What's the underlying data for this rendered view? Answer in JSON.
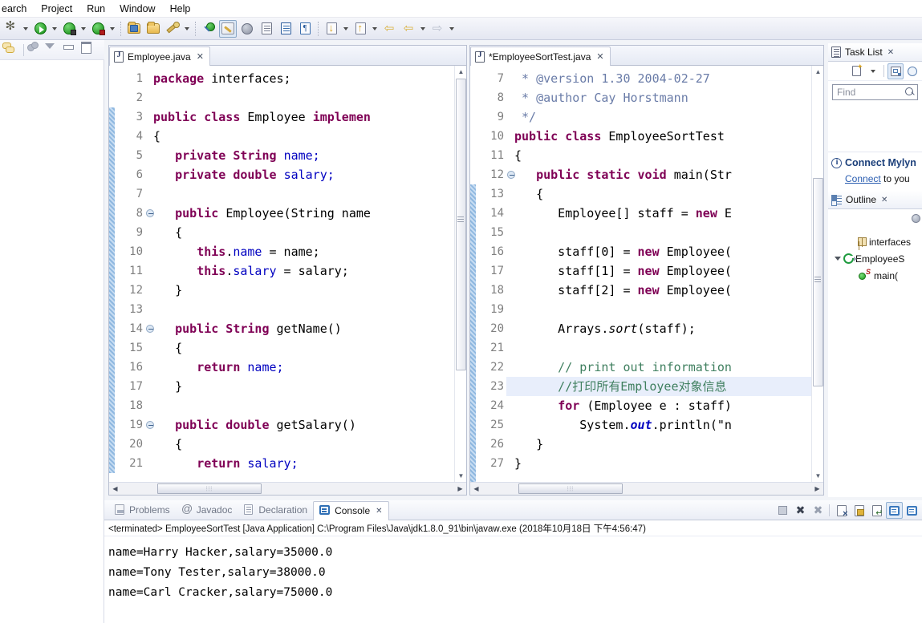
{
  "menubar": {
    "items": [
      "earch",
      "Project",
      "Run",
      "Window",
      "Help"
    ]
  },
  "toolbar": {
    "icons": [
      "debug-icon",
      "dropdown-arrow",
      "run-icon",
      "dropdown-arrow",
      "debug-as-icon",
      "dropdown-arrow",
      "coverage-icon",
      "dropdown-arrow",
      "new-java-project-icon",
      "open-folder-icon",
      "new-wizard-icon",
      "dropdown-arrow",
      "search-pin-icon",
      "toggle-mark-occurrences-icon",
      "link-icon",
      "open-type-icon",
      "open-task-icon",
      "pilcrow-icon",
      "next-annotation-icon",
      "dropdown-arrow",
      "previous-annotation-icon",
      "dropdown-arrow",
      "back-icon",
      "forward-icon",
      "dropdown-arrow",
      "forward-hollow-icon",
      "dropdown-arrow"
    ]
  },
  "left_strip": {
    "icons": [
      "link-with-editor-icon",
      "view-menu-balls-icon",
      "view-menu-icon",
      "minimize-icon",
      "maximize-icon"
    ]
  },
  "editors": [
    {
      "tab_label": "Employee.java",
      "dirty": false,
      "close_label": "✕",
      "first_line": 1,
      "lines": [
        {
          "n": 1,
          "fold": false,
          "highlight": false,
          "tokens": [
            {
              "t": "package ",
              "c": "kw"
            },
            {
              "t": "interfaces;",
              "c": "pln"
            }
          ]
        },
        {
          "n": 2,
          "fold": false,
          "highlight": false,
          "tokens": []
        },
        {
          "n": 3,
          "fold": false,
          "highlight": false,
          "tokens": [
            {
              "t": "public class ",
              "c": "kw"
            },
            {
              "t": "Employee ",
              "c": "pln"
            },
            {
              "t": "implemen",
              "c": "kw"
            }
          ]
        },
        {
          "n": 4,
          "fold": false,
          "highlight": false,
          "tokens": [
            {
              "t": "{",
              "c": "pln"
            }
          ]
        },
        {
          "n": 5,
          "fold": false,
          "highlight": false,
          "tokens": [
            {
              "t": "   ",
              "c": "pln"
            },
            {
              "t": "private String ",
              "c": "kw"
            },
            {
              "t": "name;",
              "c": "fld"
            }
          ]
        },
        {
          "n": 6,
          "fold": false,
          "highlight": false,
          "tokens": [
            {
              "t": "   ",
              "c": "pln"
            },
            {
              "t": "private double ",
              "c": "kw"
            },
            {
              "t": "salary;",
              "c": "fld"
            }
          ]
        },
        {
          "n": 7,
          "fold": false,
          "highlight": false,
          "tokens": []
        },
        {
          "n": 8,
          "fold": true,
          "highlight": false,
          "tokens": [
            {
              "t": "   ",
              "c": "pln"
            },
            {
              "t": "public ",
              "c": "kw"
            },
            {
              "t": "Employee(String name",
              "c": "pln"
            }
          ]
        },
        {
          "n": 9,
          "fold": false,
          "highlight": false,
          "tokens": [
            {
              "t": "   {",
              "c": "pln"
            }
          ]
        },
        {
          "n": 10,
          "fold": false,
          "highlight": false,
          "tokens": [
            {
              "t": "      ",
              "c": "pln"
            },
            {
              "t": "this",
              "c": "kw"
            },
            {
              "t": ".",
              "c": "pln"
            },
            {
              "t": "name",
              "c": "fld"
            },
            {
              "t": " = name;",
              "c": "pln"
            }
          ]
        },
        {
          "n": 11,
          "fold": false,
          "highlight": false,
          "tokens": [
            {
              "t": "      ",
              "c": "pln"
            },
            {
              "t": "this",
              "c": "kw"
            },
            {
              "t": ".",
              "c": "pln"
            },
            {
              "t": "salary",
              "c": "fld"
            },
            {
              "t": " = salary;",
              "c": "pln"
            }
          ]
        },
        {
          "n": 12,
          "fold": false,
          "highlight": false,
          "tokens": [
            {
              "t": "   }",
              "c": "pln"
            }
          ]
        },
        {
          "n": 13,
          "fold": false,
          "highlight": false,
          "tokens": []
        },
        {
          "n": 14,
          "fold": true,
          "highlight": false,
          "tokens": [
            {
              "t": "   ",
              "c": "pln"
            },
            {
              "t": "public String ",
              "c": "kw"
            },
            {
              "t": "getName()",
              "c": "pln"
            }
          ]
        },
        {
          "n": 15,
          "fold": false,
          "highlight": false,
          "tokens": [
            {
              "t": "   {",
              "c": "pln"
            }
          ]
        },
        {
          "n": 16,
          "fold": false,
          "highlight": false,
          "tokens": [
            {
              "t": "      ",
              "c": "pln"
            },
            {
              "t": "return ",
              "c": "kw"
            },
            {
              "t": "name;",
              "c": "fld"
            }
          ]
        },
        {
          "n": 17,
          "fold": false,
          "highlight": false,
          "tokens": [
            {
              "t": "   }",
              "c": "pln"
            }
          ]
        },
        {
          "n": 18,
          "fold": false,
          "highlight": false,
          "tokens": []
        },
        {
          "n": 19,
          "fold": true,
          "highlight": false,
          "tokens": [
            {
              "t": "   ",
              "c": "pln"
            },
            {
              "t": "public double ",
              "c": "kw"
            },
            {
              "t": "getSalary()",
              "c": "pln"
            }
          ]
        },
        {
          "n": 20,
          "fold": false,
          "highlight": false,
          "tokens": [
            {
              "t": "   {",
              "c": "pln"
            }
          ]
        },
        {
          "n": 21,
          "fold": false,
          "highlight": false,
          "tokens": [
            {
              "t": "      ",
              "c": "pln"
            },
            {
              "t": "return ",
              "c": "kw"
            },
            {
              "t": "salary;",
              "c": "fld"
            }
          ]
        }
      ]
    },
    {
      "tab_label": "*EmployeeSortTest.java",
      "dirty": true,
      "close_label": "✕",
      "first_line": 7,
      "lines": [
        {
          "n": 7,
          "fold": false,
          "highlight": false,
          "tokens": [
            {
              "t": " * ",
              "c": "doc"
            },
            {
              "t": "@version ",
              "c": "doc"
            },
            {
              "t": "1.30 2004-02-27",
              "c": "doc"
            }
          ]
        },
        {
          "n": 8,
          "fold": false,
          "highlight": false,
          "tokens": [
            {
              "t": " * ",
              "c": "doc"
            },
            {
              "t": "@author ",
              "c": "doc"
            },
            {
              "t": "Cay Horstmann",
              "c": "doc"
            }
          ]
        },
        {
          "n": 9,
          "fold": false,
          "highlight": false,
          "tokens": [
            {
              "t": " */",
              "c": "doc"
            }
          ]
        },
        {
          "n": 10,
          "fold": false,
          "highlight": false,
          "tokens": [
            {
              "t": "public class ",
              "c": "kw"
            },
            {
              "t": "EmployeeSortTest",
              "c": "pln"
            }
          ]
        },
        {
          "n": 11,
          "fold": false,
          "highlight": false,
          "tokens": [
            {
              "t": "{",
              "c": "pln"
            }
          ]
        },
        {
          "n": 12,
          "fold": true,
          "highlight": false,
          "tokens": [
            {
              "t": "   ",
              "c": "pln"
            },
            {
              "t": "public static void ",
              "c": "kw"
            },
            {
              "t": "main(Str",
              "c": "pln"
            }
          ]
        },
        {
          "n": 13,
          "fold": false,
          "highlight": false,
          "tokens": [
            {
              "t": "   {",
              "c": "pln"
            }
          ]
        },
        {
          "n": 14,
          "fold": false,
          "highlight": false,
          "tokens": [
            {
              "t": "      Employee[] staff = ",
              "c": "pln"
            },
            {
              "t": "new ",
              "c": "kw"
            },
            {
              "t": "E",
              "c": "pln"
            }
          ]
        },
        {
          "n": 15,
          "fold": false,
          "highlight": false,
          "tokens": []
        },
        {
          "n": 16,
          "fold": false,
          "highlight": false,
          "tokens": [
            {
              "t": "      staff[0] = ",
              "c": "pln"
            },
            {
              "t": "new ",
              "c": "kw"
            },
            {
              "t": "Employee(",
              "c": "pln"
            }
          ]
        },
        {
          "n": 17,
          "fold": false,
          "highlight": false,
          "tokens": [
            {
              "t": "      staff[1] = ",
              "c": "pln"
            },
            {
              "t": "new ",
              "c": "kw"
            },
            {
              "t": "Employee(",
              "c": "pln"
            }
          ]
        },
        {
          "n": 18,
          "fold": false,
          "highlight": false,
          "tokens": [
            {
              "t": "      staff[2] = ",
              "c": "pln"
            },
            {
              "t": "new ",
              "c": "kw"
            },
            {
              "t": "Employee(",
              "c": "pln"
            }
          ]
        },
        {
          "n": 19,
          "fold": false,
          "highlight": false,
          "tokens": []
        },
        {
          "n": 20,
          "fold": false,
          "highlight": false,
          "tokens": [
            {
              "t": "      Arrays.",
              "c": "pln"
            },
            {
              "t": "sort",
              "c": "ital"
            },
            {
              "t": "(staff);",
              "c": "pln"
            }
          ]
        },
        {
          "n": 21,
          "fold": false,
          "highlight": false,
          "tokens": []
        },
        {
          "n": 22,
          "fold": false,
          "highlight": false,
          "tokens": [
            {
              "t": "      // print out information",
              "c": "cmt"
            }
          ]
        },
        {
          "n": 23,
          "fold": false,
          "highlight": true,
          "tokens": [
            {
              "t": "      //打印所有Employee对象信息",
              "c": "cmt"
            }
          ]
        },
        {
          "n": 24,
          "fold": false,
          "highlight": false,
          "tokens": [
            {
              "t": "      ",
              "c": "pln"
            },
            {
              "t": "for ",
              "c": "kw"
            },
            {
              "t": "(Employee e : staff)",
              "c": "pln"
            }
          ]
        },
        {
          "n": 25,
          "fold": false,
          "highlight": false,
          "tokens": [
            {
              "t": "         System.",
              "c": "pln"
            },
            {
              "t": "out",
              "c": "fldi"
            },
            {
              "t": ".println(\"n",
              "c": "pln"
            }
          ]
        },
        {
          "n": 26,
          "fold": false,
          "highlight": false,
          "tokens": [
            {
              "t": "   }",
              "c": "pln"
            }
          ]
        },
        {
          "n": 27,
          "fold": false,
          "highlight": false,
          "tokens": [
            {
              "t": "}",
              "c": "pln"
            }
          ]
        }
      ]
    }
  ],
  "task_list": {
    "title": "Task List",
    "close_label": "✕",
    "tools": [
      "new-task-icon",
      "dropdown-arrow",
      "categorize-icon",
      "focus-icon"
    ],
    "find_placeholder": "Find",
    "find_value": ""
  },
  "mylyn": {
    "title": "Connect Mylyn",
    "link_text": "Connect",
    "rest_text": " to you"
  },
  "outline": {
    "title": "Outline",
    "close_label": "✕",
    "items": [
      {
        "label": "interfaces",
        "icon": "package-icon",
        "indent": 1,
        "twisty": "none"
      },
      {
        "label": "EmployeeS",
        "icon": "class-icon",
        "indent": 0,
        "twisty": "open"
      },
      {
        "label": "main(",
        "icon": "method-icon",
        "indent": 2,
        "twisty": "none",
        "modifier": "S"
      }
    ]
  },
  "console": {
    "tabs": [
      {
        "label": "Problems",
        "icon": "problems-icon",
        "active": false
      },
      {
        "label": "Javadoc",
        "icon": "javadoc-icon",
        "active": false
      },
      {
        "label": "Declaration",
        "icon": "declaration-icon",
        "active": false
      },
      {
        "label": "Console",
        "icon": "console-icon",
        "active": true,
        "close_label": "✕"
      }
    ],
    "tools": [
      "terminate-icon",
      "remove-launch-icon",
      "remove-all-launches-icon",
      "clear-console-icon",
      "scroll-lock-icon",
      "word-wrap-icon",
      "display-console-icon",
      "open-console-icon"
    ],
    "launch_line": "<terminated> EmployeeSortTest [Java Application] C:\\Program Files\\Java\\jdk1.8.0_91\\bin\\javaw.exe (2018年10月18日 下午4:56:47)",
    "output": [
      "name=Harry Hacker,salary=35000.0",
      "name=Tony Tester,salary=38000.0",
      "name=Carl Cracker,salary=75000.0"
    ]
  },
  "colors": {
    "keyword": "#7f0055",
    "field": "#0000c0",
    "comment": "#3f7f5f",
    "javadoc": "#6a7ca8",
    "highlight_line": "#e8eefb",
    "accent": "#2a5db0"
  }
}
